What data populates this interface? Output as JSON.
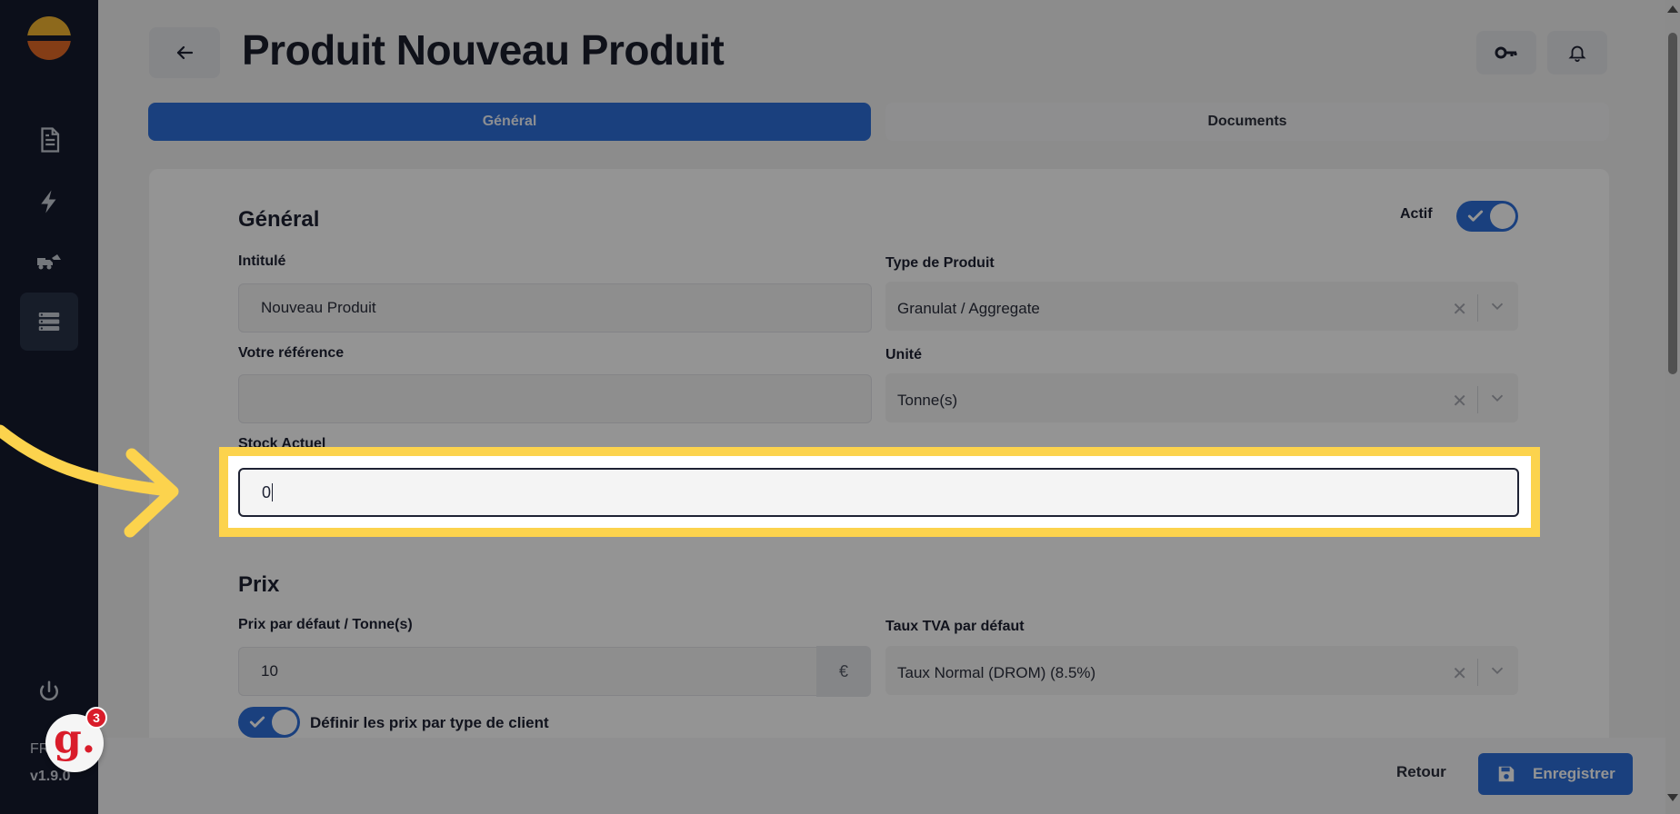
{
  "sidebar": {
    "icons": [
      "document-icon",
      "lightning-icon",
      "truck-icon",
      "list-icon",
      "power-icon"
    ],
    "fr_label": "FR",
    "version": "v1.9.0",
    "badge_count": "3",
    "badge_letter": "g."
  },
  "header": {
    "title": "Produit Nouveau Produit"
  },
  "tabs": [
    {
      "label": "Général"
    },
    {
      "label": "Documents"
    }
  ],
  "general": {
    "title": "Général",
    "actif_label": "Actif",
    "intitule_label": "Intitulé",
    "intitule_value": "Nouveau Produit",
    "type_label": "Type de Produit",
    "type_value": "Granulat / Aggregate",
    "reference_label": "Votre référence",
    "reference_value": "",
    "unite_label": "Unité",
    "unite_value": "Tonne(s)",
    "stock_label": "Stock Actuel",
    "stock_value": "0"
  },
  "prix": {
    "title": "Prix",
    "prix_label": "Prix par défaut / Tonne(s)",
    "prix_value": "10",
    "currency": "€",
    "tva_label": "Taux TVA par défaut",
    "tva_value": "Taux Normal (DROM) (8.5%)",
    "client_toggle_label": "Définir les prix par type de client"
  },
  "footer": {
    "retour_label": "Retour",
    "save_label": "Enregistrer"
  },
  "colors": {
    "sidebar_bg": "#151b2e",
    "accent": "#2d6fd9",
    "highlight": "#fcd34d"
  }
}
